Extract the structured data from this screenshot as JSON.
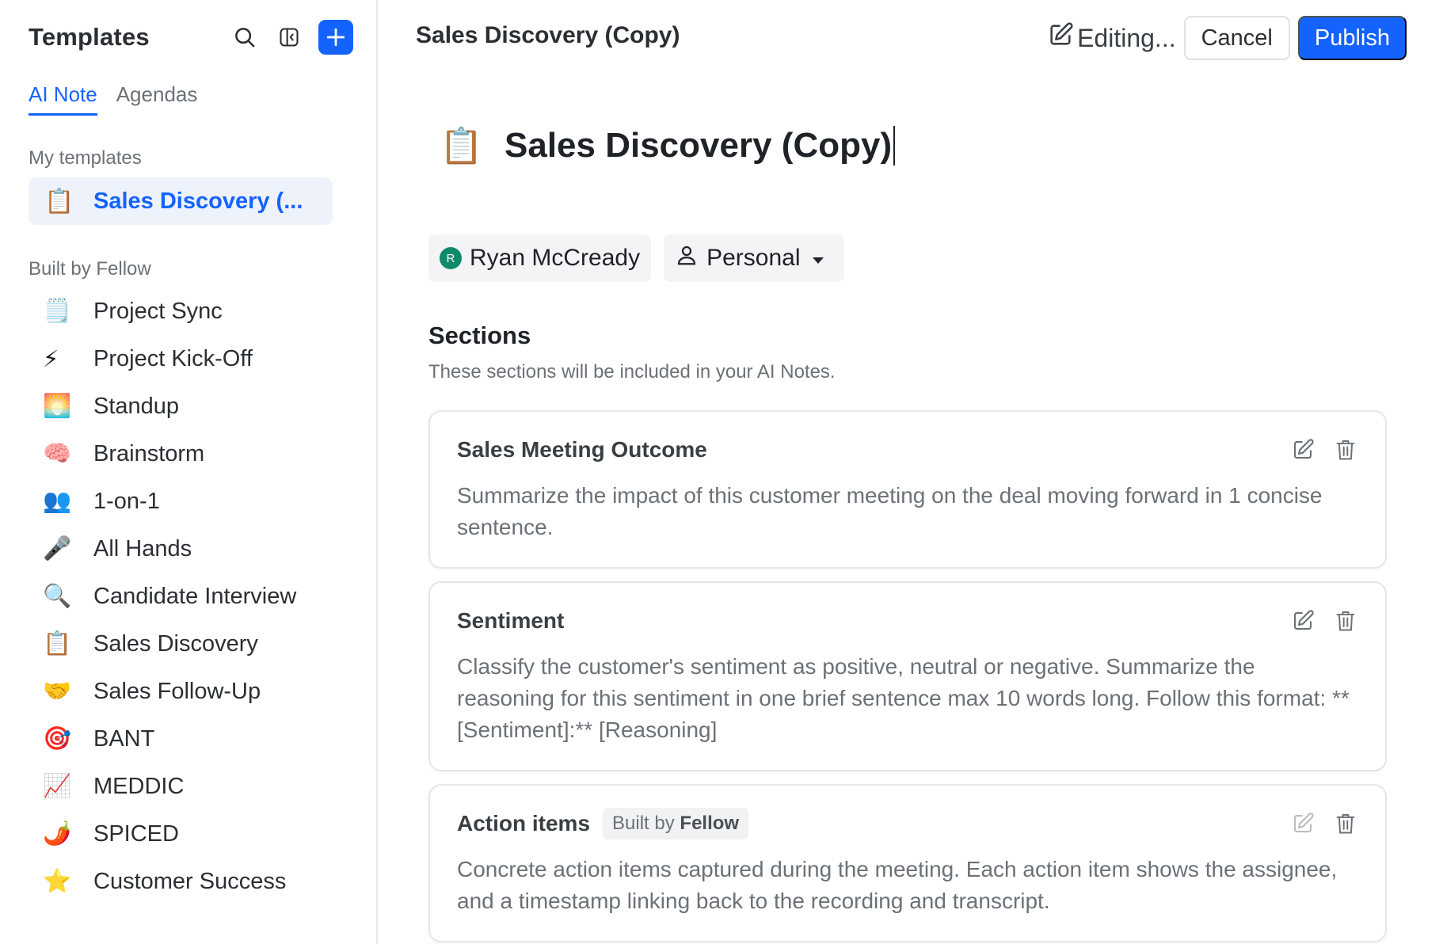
{
  "sidebar": {
    "title": "Templates",
    "tabs": [
      {
        "label": "AI Note",
        "active": true
      },
      {
        "label": "Agendas",
        "active": false
      }
    ],
    "my_templates_label": "My templates",
    "my_templates": [
      {
        "emoji": "📋",
        "label": "Sales Discovery (..."
      }
    ],
    "built_by_label": "Built by Fellow",
    "built_items": [
      {
        "emoji": "🗒️",
        "label": "Project Sync",
        "icon": "notepad-icon"
      },
      {
        "emoji": "⚡",
        "label": "Project Kick-Off",
        "icon": "lightning-icon"
      },
      {
        "emoji": "🌅",
        "label": "Standup",
        "icon": "sunrise-icon"
      },
      {
        "emoji": "🧠",
        "label": "Brainstorm",
        "icon": "brain-icon"
      },
      {
        "emoji": "👥",
        "label": "1-on-1",
        "icon": "people-icon"
      },
      {
        "emoji": "🎤",
        "label": "All Hands",
        "icon": "microphone-icon"
      },
      {
        "emoji": "🔍",
        "label": "Candidate Interview",
        "icon": "magnifier-icon"
      },
      {
        "emoji": "📋",
        "label": "Sales Discovery",
        "icon": "clipboard-icon"
      },
      {
        "emoji": "🤝",
        "label": "Sales Follow-Up",
        "icon": "handshake-icon"
      },
      {
        "emoji": "🎯",
        "label": "BANT",
        "icon": "target-icon"
      },
      {
        "emoji": "📈",
        "label": "MEDDIC",
        "icon": "chart-increasing-icon"
      },
      {
        "emoji": "🌶️",
        "label": "SPICED",
        "icon": "chili-pepper-icon"
      },
      {
        "emoji": "⭐",
        "label": "Customer Success",
        "icon": "star-icon"
      }
    ]
  },
  "topbar": {
    "title": "Sales Discovery (Copy)",
    "editing_label": "Editing...",
    "cancel_label": "Cancel",
    "publish_label": "Publish"
  },
  "document": {
    "emoji": "📋",
    "title": "Sales Discovery (Copy)",
    "owner": {
      "initial": "R",
      "name": "Ryan McCready"
    },
    "visibility": "Personal"
  },
  "sections": {
    "heading": "Sections",
    "subheading": "These sections will be included in your AI Notes.",
    "items": [
      {
        "title": "Sales Meeting Outcome",
        "body": "Summarize the impact of this customer meeting on the deal moving forward in 1 concise sentence.",
        "badge_prefix": "",
        "badge_strong": ""
      },
      {
        "title": "Sentiment",
        "body": "Classify the customer's sentiment as positive, neutral or negative. Summarize the reasoning for this sentiment in one brief sentence max 10 words long. Follow this format: **[Sentiment]:** [Reasoning]",
        "badge_prefix": "",
        "badge_strong": ""
      },
      {
        "title": "Action items",
        "body": "Concrete action items captured during the meeting. Each action item shows the assignee, and a timestamp linking back to the recording and transcript.",
        "badge_prefix": "Built by ",
        "badge_strong": "Fellow"
      }
    ]
  },
  "colors": {
    "accent": "#1463ff",
    "avatar": "#0f8a6b",
    "active_item_bg": "#eef2fb"
  }
}
